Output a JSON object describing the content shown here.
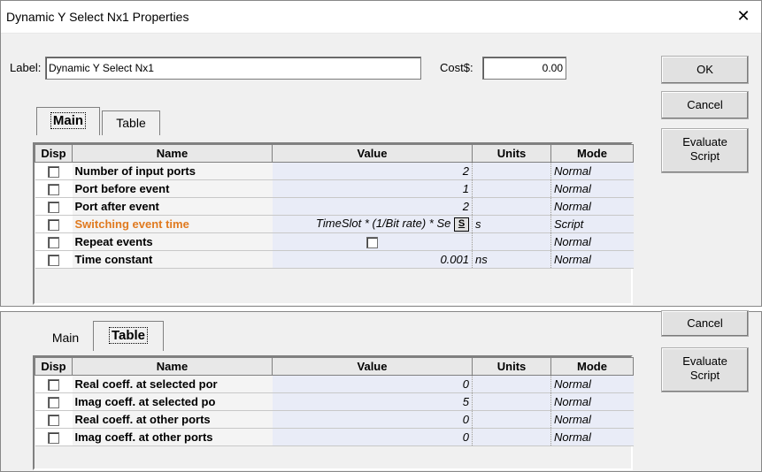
{
  "window": {
    "title": "Dynamic Y Select Nx1 Properties"
  },
  "label": {
    "caption": "Label:",
    "value": "Dynamic Y Select Nx1"
  },
  "cost": {
    "caption": "Cost$:",
    "value": "0.00"
  },
  "buttons": {
    "ok": "OK",
    "cancel": "Cancel",
    "evaluate": "Evaluate\nScript"
  },
  "tabs": {
    "main": "Main",
    "table": "Table"
  },
  "columns": [
    "Disp",
    "Name",
    "Value",
    "Units",
    "Mode"
  ],
  "main_rows": [
    {
      "name": "Number of input ports",
      "value": "2",
      "units": "",
      "mode": "Normal"
    },
    {
      "name": "Port before event",
      "value": "1",
      "units": "",
      "mode": "Normal"
    },
    {
      "name": "Port after event",
      "value": "2",
      "units": "",
      "mode": "Normal"
    },
    {
      "name": "Switching event time",
      "value": "TimeSlot * (1/Bit rate) * Se",
      "units": "s",
      "mode": "Script"
    },
    {
      "name": "Repeat events",
      "value": "",
      "units": "",
      "mode": "Normal"
    },
    {
      "name": "Time constant",
      "value": "0.001",
      "units": "ns",
      "mode": "Normal"
    }
  ],
  "script_button": "S",
  "table_rows": [
    {
      "name": "Real coeff. at selected por",
      "value": "0",
      "units": "",
      "mode": "Normal"
    },
    {
      "name": "Imag coeff. at selected po",
      "value": "5",
      "units": "",
      "mode": "Normal"
    },
    {
      "name": "Real coeff. at other ports",
      "value": "0",
      "units": "",
      "mode": "Normal"
    },
    {
      "name": "Imag coeff. at other ports",
      "value": "0",
      "units": "",
      "mode": "Normal"
    }
  ]
}
